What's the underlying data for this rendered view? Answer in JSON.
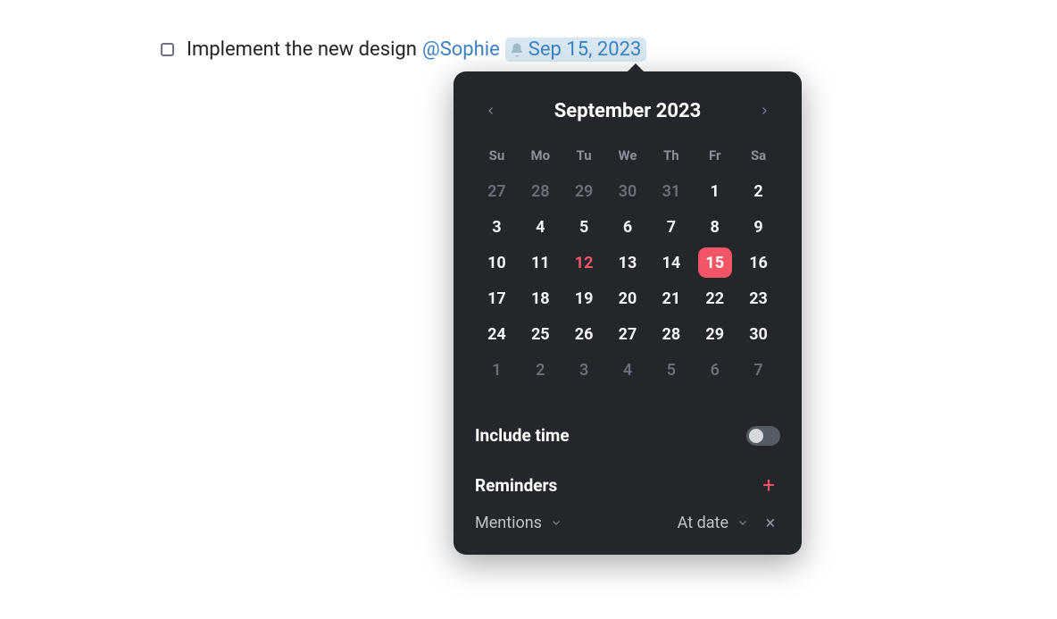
{
  "task": {
    "text": "Implement the new design",
    "mention": "@Sophie",
    "date_label": "Sep 15, 2023"
  },
  "calendar": {
    "title": "September 2023",
    "dow": [
      "Su",
      "Mo",
      "Tu",
      "We",
      "Th",
      "Fr",
      "Sa"
    ],
    "weeks": [
      [
        {
          "n": "27",
          "other": true
        },
        {
          "n": "28",
          "other": true
        },
        {
          "n": "29",
          "other": true
        },
        {
          "n": "30",
          "other": true
        },
        {
          "n": "31",
          "other": true
        },
        {
          "n": "1"
        },
        {
          "n": "2"
        }
      ],
      [
        {
          "n": "3"
        },
        {
          "n": "4"
        },
        {
          "n": "5"
        },
        {
          "n": "6"
        },
        {
          "n": "7"
        },
        {
          "n": "8"
        },
        {
          "n": "9"
        }
      ],
      [
        {
          "n": "10"
        },
        {
          "n": "11"
        },
        {
          "n": "12",
          "today": true
        },
        {
          "n": "13"
        },
        {
          "n": "14"
        },
        {
          "n": "15",
          "selected": true
        },
        {
          "n": "16"
        }
      ],
      [
        {
          "n": "17"
        },
        {
          "n": "18"
        },
        {
          "n": "19"
        },
        {
          "n": "20"
        },
        {
          "n": "21"
        },
        {
          "n": "22"
        },
        {
          "n": "23"
        }
      ],
      [
        {
          "n": "24"
        },
        {
          "n": "25"
        },
        {
          "n": "26"
        },
        {
          "n": "27"
        },
        {
          "n": "28"
        },
        {
          "n": "29"
        },
        {
          "n": "30"
        }
      ],
      [
        {
          "n": "1",
          "other": true
        },
        {
          "n": "2",
          "other": true
        },
        {
          "n": "3",
          "other": true
        },
        {
          "n": "4",
          "other": true
        },
        {
          "n": "5",
          "other": true
        },
        {
          "n": "6",
          "other": true
        },
        {
          "n": "7",
          "other": true
        }
      ]
    ]
  },
  "sections": {
    "include_time": "Include time",
    "reminders": "Reminders"
  },
  "reminder_row": {
    "type": "Mentions",
    "when": "At date"
  },
  "icons": {
    "bell": "bell-icon",
    "chevron_left": "chevron-left-icon",
    "chevron_right": "chevron-right-icon",
    "chevron_down": "chevron-down-icon",
    "plus": "plus-icon",
    "close": "close-icon"
  }
}
